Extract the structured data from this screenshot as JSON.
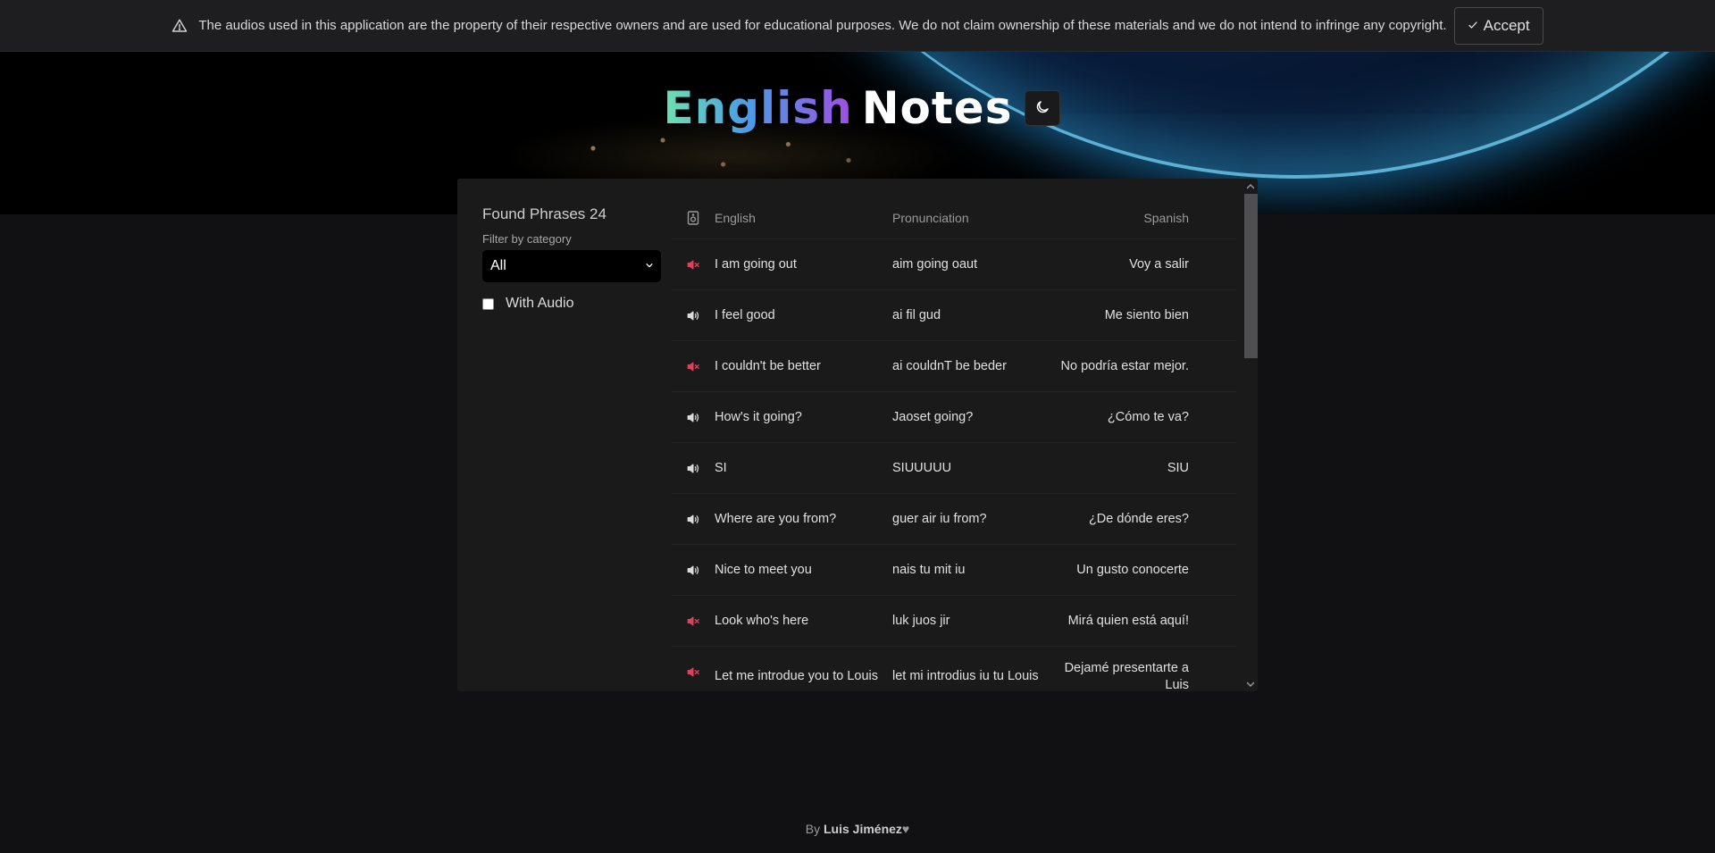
{
  "banner": {
    "message": "The audios used in this application are the property of their respective owners and are used for educational purposes. We do not claim ownership of these materials and we do not intend to infringe any copyright.",
    "accept_label": "Accept",
    "icons": {
      "warning": "warning-triangle-icon",
      "accept": "check-icon"
    }
  },
  "header": {
    "title_part1": "English",
    "title_part2": "Notes",
    "theme_toggle_icon": "moon-icon"
  },
  "sidebar": {
    "found_label": "Found Phrases 24",
    "filter_label": "Filter by category",
    "filter_value": "All",
    "with_audio_label": "With Audio",
    "with_audio_checked": false
  },
  "table": {
    "headers": {
      "icon": "audio-file-icon",
      "english": "English",
      "pronunciation": "Pronunciation",
      "spanish": "Spanish"
    },
    "rows": [
      {
        "audio": "muted",
        "english": "I am going out",
        "pronunciation": "aim going oaut",
        "spanish": "Voy a salir"
      },
      {
        "audio": "on",
        "english": "I feel good",
        "pronunciation": "ai fil gud",
        "spanish": "Me siento bien"
      },
      {
        "audio": "muted",
        "english": "I couldn't be better",
        "pronunciation": "ai couldnT be beder",
        "spanish": "No podría estar mejor."
      },
      {
        "audio": "on",
        "english": "How's it going?",
        "pronunciation": "Jaoset going?",
        "spanish": "¿Cómo te va?"
      },
      {
        "audio": "on",
        "english": "SI",
        "pronunciation": "SIUUUUU",
        "spanish": "SIU"
      },
      {
        "audio": "on",
        "english": "Where are you from?",
        "pronunciation": "guer air iu from?",
        "spanish": "¿De dónde eres?"
      },
      {
        "audio": "on",
        "english": "Nice to meet you",
        "pronunciation": "nais tu mit iu",
        "spanish": "Un gusto conocerte"
      },
      {
        "audio": "muted",
        "english": "Look who's here",
        "pronunciation": "luk juos jir",
        "spanish": "Mirá quien está aquí!"
      },
      {
        "audio": "muted",
        "english": "Let me introdue you to Louis",
        "pronunciation": "let mi introdius iu tu Louis",
        "spanish": "Dejamé presentarte a Luis"
      }
    ]
  },
  "footer": {
    "prefix": "By",
    "author": "Luis Jiménez",
    "heart": "♥"
  },
  "colors": {
    "muted_icon": "#e0405e",
    "on_icon": "#dcdcdc",
    "background": "#111113",
    "card": "#1a1a1b"
  }
}
